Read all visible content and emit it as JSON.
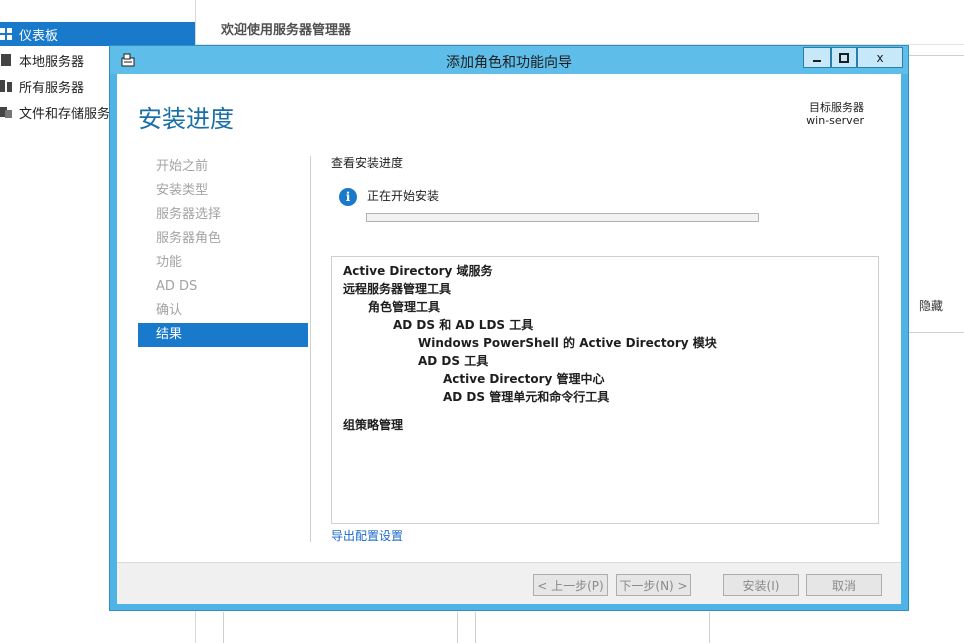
{
  "background": {
    "nav": [
      {
        "label": "仪表板",
        "icon": "dashboard-icon",
        "active": true
      },
      {
        "label": "本地服务器",
        "icon": "server-icon",
        "active": false
      },
      {
        "label": "所有服务器",
        "icon": "servers-icon",
        "active": false
      },
      {
        "label": "文件和存储服务",
        "icon": "file-storage-icon",
        "active": false
      }
    ],
    "header": "欢迎使用服务器管理器",
    "hide_label": "隐藏"
  },
  "dialog": {
    "title": "添加角色和功能向导",
    "window_buttons": {
      "minimize": "▁",
      "maximize": "□",
      "close": "x"
    },
    "page_heading": "安装进度",
    "target_server_label": "目标服务器",
    "target_server_name": "win-server",
    "steps": [
      {
        "label": "开始之前",
        "active": false
      },
      {
        "label": "安装类型",
        "active": false
      },
      {
        "label": "服务器选择",
        "active": false
      },
      {
        "label": "服务器角色",
        "active": false
      },
      {
        "label": "功能",
        "active": false
      },
      {
        "label": "AD DS",
        "active": false
      },
      {
        "label": "确认",
        "active": false
      },
      {
        "label": "结果",
        "active": true
      }
    ],
    "content_title": "查看安装进度",
    "status": {
      "text": "正在开始安装",
      "icon": "info-icon",
      "progress": 0
    },
    "results": [
      {
        "text": "Active Directory 域服务",
        "level": 0
      },
      {
        "text": "远程服务器管理工具",
        "level": 0
      },
      {
        "text": "角色管理工具",
        "level": 1
      },
      {
        "text": "AD DS 和 AD LDS 工具",
        "level": 2
      },
      {
        "text": "Windows PowerShell 的 Active Directory 模块",
        "level": 3
      },
      {
        "text": "AD DS 工具",
        "level": 3
      },
      {
        "text": "Active Directory 管理中心",
        "level": 4
      },
      {
        "text": "AD DS 管理单元和命令行工具",
        "level": 4
      },
      {
        "text": "组策略管理",
        "level": 0
      }
    ],
    "export_link": "导出配置设置",
    "buttons": {
      "previous": "< 上一步(P)",
      "next": "下一步(N) >",
      "install": "安装(I)",
      "cancel": "取消"
    }
  },
  "colors": {
    "accent": "#1979ca",
    "titlebar": "#5ebde9",
    "heading": "#1a6fa7",
    "link": "#1b6ac9"
  }
}
